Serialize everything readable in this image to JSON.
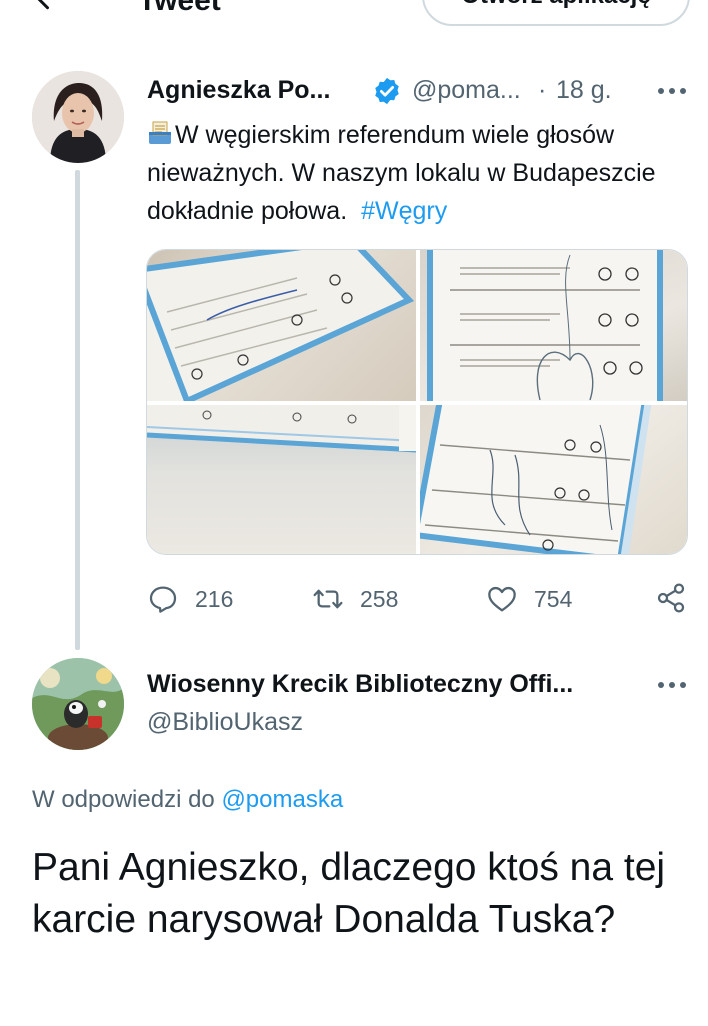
{
  "header": {
    "title": "Tweet",
    "open_app_label": "Otwórz aplikację"
  },
  "tweet": {
    "author_name": "Agnieszka Po...",
    "author_handle": "@poma...",
    "separator": "·",
    "time": "18 g.",
    "emoji_icon": "ballot-box-icon",
    "text": "W węgierskim referendum wiele głosów nieważnych. W naszym lokalu w Budapeszcie dokładnie połowa.",
    "hashtag": "#Węgry",
    "replies": "216",
    "retweets": "258",
    "likes": "754"
  },
  "reply": {
    "author_name": "Wiosenny Krecik Biblioteczny Offi...",
    "author_handle": "@BiblioUkasz",
    "reply_to_prefix": "W odpowiedzi do",
    "reply_to_mention": "@pomaska",
    "text": "Pani Agnieszko, dlaczego ktoś na tej karcie narysował Donalda Tuska?"
  },
  "colors": {
    "accent": "#1d9bf0",
    "secondary_text": "#536471",
    "thread_line": "#cfd9de"
  }
}
